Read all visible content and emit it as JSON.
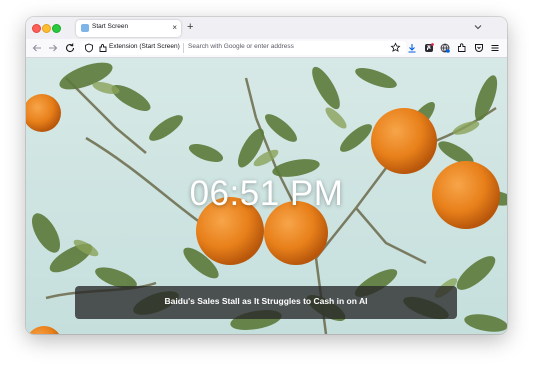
{
  "browser": {
    "tab": {
      "title": "Start Screen",
      "close_glyph": "×"
    },
    "new_tab_glyph": "+",
    "urlbar": {
      "identity_label": "Extension (Start Screen)",
      "placeholder": "Search with Google or enter address"
    },
    "toolbar_icons": [
      "back-icon",
      "forward-icon",
      "reload-icon",
      "shield-icon",
      "extension-icon",
      "star-icon",
      "downloads-icon",
      "extension-s-icon",
      "extension-globe-icon",
      "extensions-puzzle-icon",
      "pocket-icon",
      "menu-icon"
    ]
  },
  "page": {
    "clock": "06:51 PM",
    "headline": "Baidu's Sales Stall as It Struggles to Cash in on AI"
  },
  "colors": {
    "accent_blue": "#0060df",
    "fruit_orange": "#ef8a1f",
    "sky": "#cfe4e4",
    "leaf_green": "#5c7a3a"
  }
}
